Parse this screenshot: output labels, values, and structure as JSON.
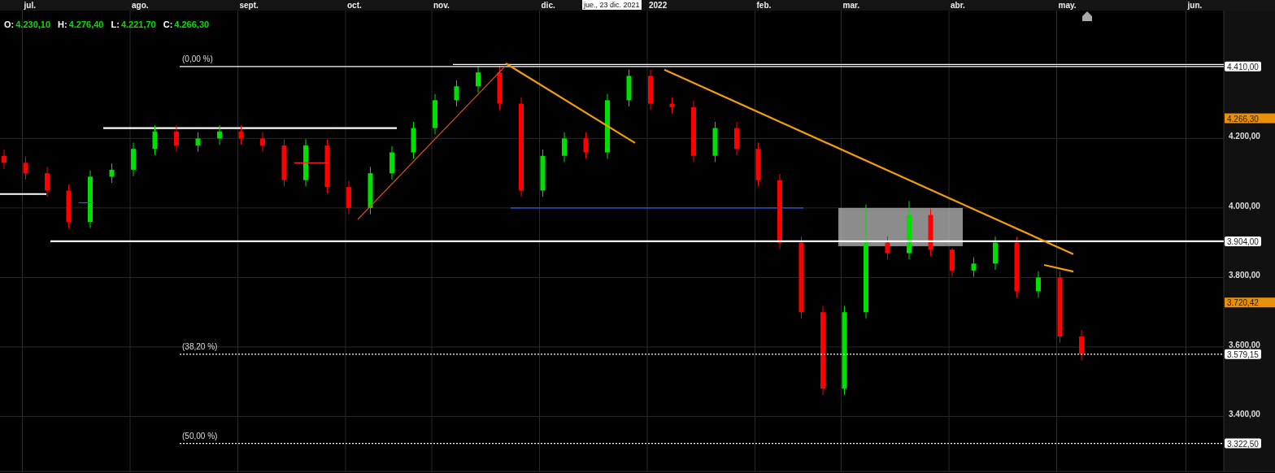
{
  "ohlc": [
    {
      "label": "O:",
      "value": "4.230,10"
    },
    {
      "label": "H:",
      "value": "4.276,40"
    },
    {
      "label": "L:",
      "value": "4.221,70"
    },
    {
      "label": "C:",
      "value": "4.266,30"
    }
  ],
  "crosshair_date": "jue., 23 dic. 2021",
  "chart_data": {
    "type": "candlestick",
    "grid": true,
    "categories": [
      null,
      "jul.",
      null,
      null,
      null,
      null,
      "ago.",
      null,
      null,
      null,
      null,
      "sept.",
      null,
      null,
      null,
      null,
      "oct.",
      null,
      null,
      null,
      "nov.",
      null,
      null,
      null,
      null,
      "dic.",
      null,
      null,
      null,
      null,
      "2022",
      null,
      null,
      null,
      null,
      "feb.",
      null,
      null,
      null,
      "mar.",
      null,
      null,
      null,
      null,
      "abr.",
      null,
      null,
      null,
      null,
      "may.",
      null,
      null,
      null,
      null,
      null,
      "jun."
    ],
    "ohlc": [
      [
        4150,
        4168,
        4112,
        4130
      ],
      [
        4130,
        4148,
        4082,
        4100
      ],
      [
        4100,
        4118,
        4032,
        4050
      ],
      [
        4050,
        4068,
        3942,
        3960
      ],
      [
        3960,
        4108,
        3942,
        4090
      ],
      [
        4090,
        4128,
        4072,
        4110
      ],
      [
        4110,
        4188,
        4092,
        4170
      ],
      [
        4170,
        4238,
        4152,
        4220
      ],
      [
        4220,
        4238,
        4162,
        4180
      ],
      [
        4180,
        4218,
        4162,
        4200
      ],
      [
        4200,
        4238,
        4182,
        4220
      ],
      [
        4220,
        4238,
        4182,
        4200
      ],
      [
        4200,
        4218,
        4162,
        4180
      ],
      [
        4180,
        4198,
        4062,
        4080
      ],
      [
        4080,
        4198,
        4062,
        4180
      ],
      [
        4180,
        4198,
        4042,
        4060
      ],
      [
        4060,
        4078,
        3982,
        4000
      ],
      [
        4000,
        4118,
        3982,
        4100
      ],
      [
        4100,
        4178,
        4082,
        4160
      ],
      [
        4160,
        4248,
        4142,
        4230
      ],
      [
        4230,
        4328,
        4212,
        4310
      ],
      [
        4310,
        4368,
        4292,
        4350
      ],
      [
        4350,
        4408,
        4332,
        4390
      ],
      [
        4390,
        4408,
        4282,
        4300
      ],
      [
        4300,
        4318,
        4032,
        4050
      ],
      [
        4050,
        4168,
        4032,
        4150
      ],
      [
        4150,
        4218,
        4132,
        4200
      ],
      [
        4200,
        4218,
        4142,
        4160
      ],
      [
        4160,
        4328,
        4142,
        4310
      ],
      [
        4310,
        4398,
        4292,
        4380
      ],
      [
        4380,
        4398,
        4282,
        4300
      ],
      [
        4300,
        4318,
        4272,
        4290
      ],
      [
        4290,
        4308,
        4132,
        4150
      ],
      [
        4150,
        4248,
        4132,
        4230
      ],
      [
        4230,
        4248,
        4152,
        4170
      ],
      [
        4170,
        4188,
        4062,
        4080
      ],
      [
        4080,
        4098,
        3882,
        3900
      ],
      [
        3900,
        3918,
        3682,
        3700
      ],
      [
        3700,
        3718,
        3462,
        3480
      ],
      [
        3480,
        3718,
        3462,
        3700
      ],
      [
        3700,
        4010,
        3682,
        3900
      ],
      [
        3900,
        3918,
        3852,
        3870
      ],
      [
        3870,
        4020,
        3852,
        3980
      ],
      [
        3980,
        3998,
        3862,
        3880
      ],
      [
        3880,
        3885,
        3802,
        3820
      ],
      [
        3820,
        3858,
        3802,
        3840
      ],
      [
        3840,
        3918,
        3822,
        3900
      ],
      [
        3900,
        3918,
        3742,
        3760
      ],
      [
        3760,
        3818,
        3742,
        3800
      ],
      [
        3800,
        3818,
        3612,
        3630
      ],
      [
        3630,
        3648,
        3562,
        3580
      ],
      null,
      null,
      null,
      null,
      null
    ],
    "ylim": [
      3242,
      4568
    ],
    "ref_lines": [
      {
        "axis": "y",
        "value": 4413,
        "color": "#ffffff"
      },
      {
        "axis": "y",
        "value": 4230,
        "color": "#ffffff"
      },
      {
        "axis": "y",
        "value": 4000,
        "color": "#1f5fff"
      }
    ],
    "yticks": [
      {
        "value": 3400,
        "label": "3.400,00"
      },
      {
        "value": 3600,
        "label": "3.600,00"
      },
      {
        "value": 3800,
        "label": "3.800,00"
      },
      {
        "value": 4000,
        "label": "4.000,00"
      },
      {
        "value": 4200,
        "label": "4.200,00"
      }
    ]
  },
  "drawings": [
    {
      "kind": "fibonacci",
      "label": "(0,00 %)",
      "tag": "4.410,00"
    },
    {
      "kind": "price_marker",
      "tag": "4.266,30"
    },
    {
      "kind": "support",
      "tag": "3.904,00"
    },
    {
      "kind": "price_marker",
      "tag": "3.720,42"
    },
    {
      "kind": "fibonacci",
      "label": "(38,20 %)",
      "tag": "3.579,15"
    },
    {
      "kind": "fibonacci",
      "label": "(50,00 %)",
      "tag": "3.322,50"
    }
  ]
}
